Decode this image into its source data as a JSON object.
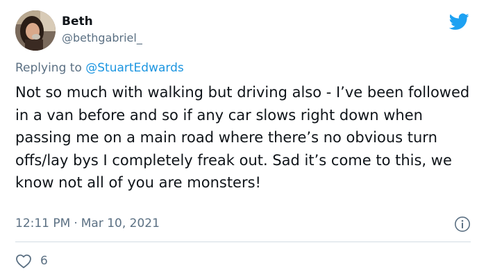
{
  "author": {
    "name": "Beth",
    "handle": "@bethgabriel_"
  },
  "reply": {
    "prefix": "Replying to",
    "mention": "@StuartEdwards"
  },
  "tweet": {
    "text": "Not so much with walking but driving also - I’ve been followed in a van before and so if any car slows right down when passing me on a main road where there’s no obvious turn offs/lay bys I completely freak out. Sad it’s come to this, we know not all of you are monsters!"
  },
  "meta": {
    "time": "12:11 PM",
    "separator": "·",
    "date": "Mar 10, 2021"
  },
  "actions": {
    "like_count": "6"
  },
  "icons": {
    "brand": "twitter-bird-icon",
    "info": "info-icon",
    "like": "heart-icon"
  },
  "colors": {
    "brand": "#1da1f2",
    "link": "#1b95e0",
    "secondary_text": "#5b7083",
    "primary_text": "#0f1419",
    "divider": "#d3dce3"
  }
}
